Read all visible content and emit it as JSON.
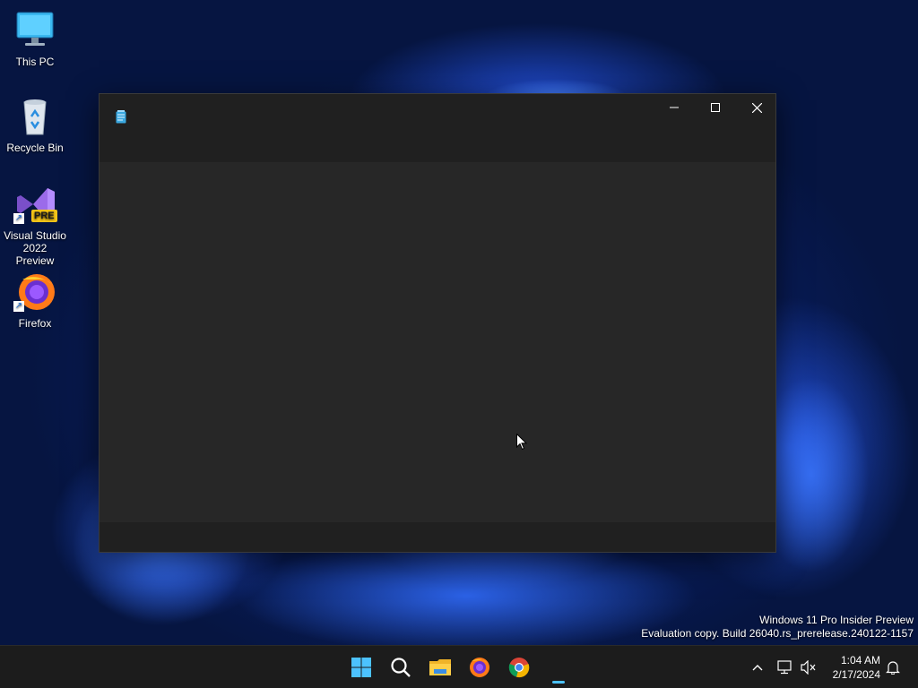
{
  "desktop": {
    "icons": [
      {
        "label": "This PC"
      },
      {
        "label": "Recycle Bin"
      },
      {
        "label": "Visual Studio 2022 Preview",
        "badge": "PRE"
      },
      {
        "label": "Firefox"
      }
    ]
  },
  "window": {
    "app_icon": "notepad-icon",
    "controls": [
      "minimize-icon",
      "maximize-icon",
      "close-icon"
    ]
  },
  "watermark": {
    "line1": "Windows 11 Pro Insider Preview",
    "line2": "Evaluation copy. Build 26040.rs_prerelease.240122-1157"
  },
  "taskbar": {
    "apps": [
      "start-icon",
      "search-icon",
      "file-explorer-icon",
      "firefox-icon",
      "chrome-icon",
      "notepad-running-icon"
    ],
    "tray": [
      "chevron-up-icon",
      "network-icon",
      "volume-muted-icon",
      "notification-icon"
    ],
    "time": "1:04 AM",
    "date": "2/17/2024"
  },
  "colors": {
    "accent": "#4cc2ff",
    "window_bg": "#202020",
    "doc_bg": "#272727",
    "taskbar_bg": "#1c1c1c"
  }
}
